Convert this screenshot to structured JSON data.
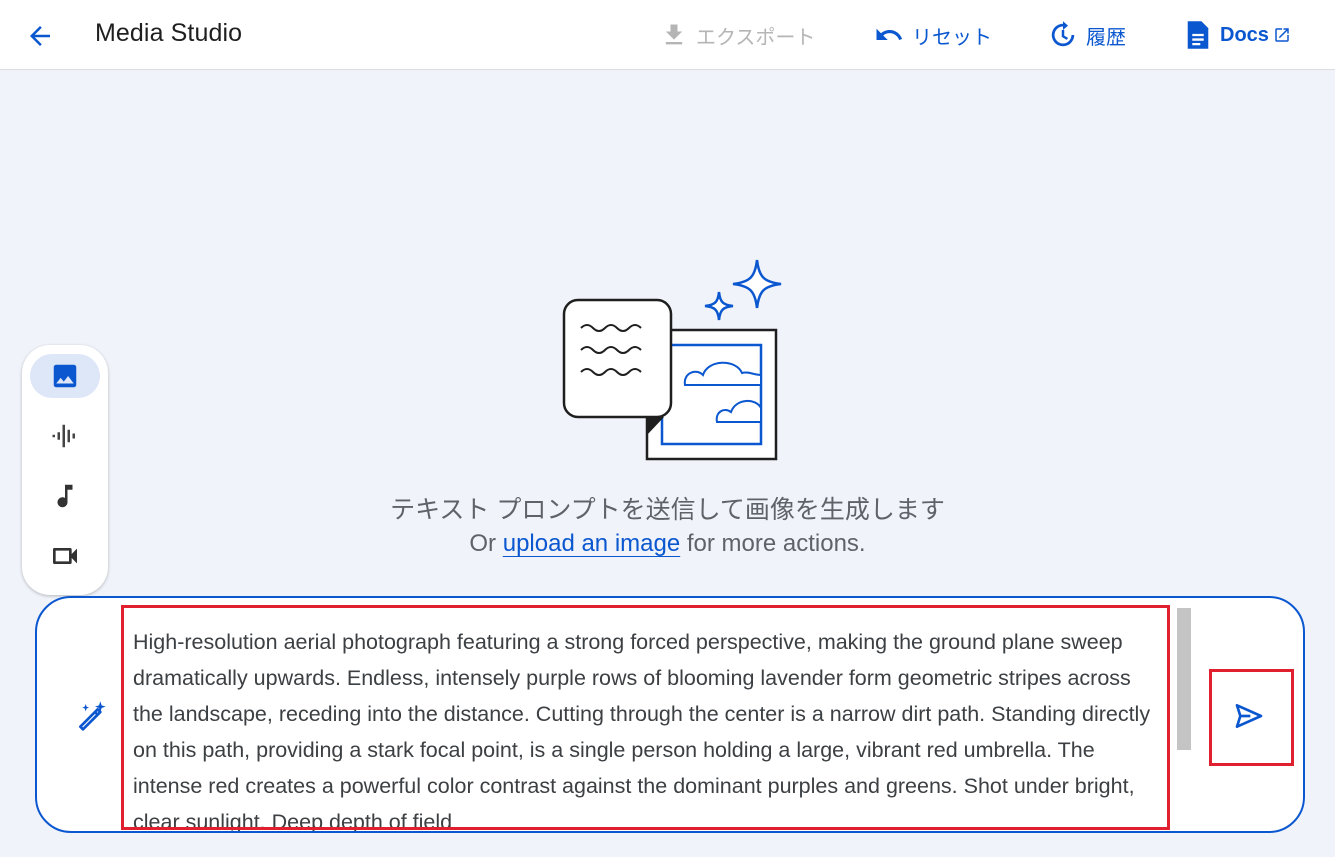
{
  "header": {
    "back_icon": "arrow-back-icon",
    "title": "Media Studio",
    "actions": {
      "export_label": "エクスポート",
      "reset_label": "リセット",
      "history_label": "履歴",
      "docs_label": "Docs"
    }
  },
  "empty_state": {
    "title": "テキスト プロンプトを送信して画像を生成します",
    "sub_prefix": "Or ",
    "sub_link": "upload an image",
    "sub_suffix": " for more actions."
  },
  "mode_rail": {
    "items": [
      {
        "icon": "image-icon",
        "active": true
      },
      {
        "icon": "audio-waveform-icon",
        "active": false
      },
      {
        "icon": "music-note-icon",
        "active": false
      },
      {
        "icon": "video-camera-icon",
        "active": false
      }
    ]
  },
  "prompt": {
    "text": "High-resolution aerial photograph featuring a strong forced perspective, making the ground plane sweep dramatically upwards. Endless, intensely purple rows of blooming lavender form geometric stripes across the landscape, receding into the distance. Cutting through the center is a narrow dirt path. Standing directly on this path, providing a stark focal point, is a single person holding a large, vibrant red umbrella. The intense red creates a powerful color contrast against the dominant purples and greens. Shot under bright, clear sunlight. Deep depth of field"
  },
  "colors": {
    "accent": "#0b57d0",
    "highlight": "#e0202e",
    "background": "#f0f4fa"
  }
}
